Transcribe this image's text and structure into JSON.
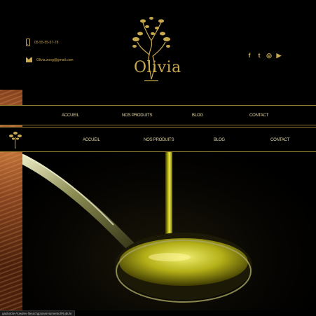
{
  "header": {
    "phone": "05-55-55-57-78",
    "email": "Olivia.zoog@gmail.com",
    "logo_text": "Olivia"
  },
  "socials": [
    {
      "icon": "facebook-icon",
      "glyph": "f"
    },
    {
      "icon": "twitter-icon",
      "glyph": "t"
    },
    {
      "icon": "instagram-icon",
      "glyph": "◎"
    },
    {
      "icon": "youtube-icon",
      "glyph": "▶"
    }
  ],
  "nav_primary": {
    "items": [
      "ACCUEIL",
      "NOS PRODUITS",
      "BLOG",
      "CONTACT"
    ]
  },
  "nav_sticky": {
    "items": [
      "ACCUEIL",
      "NOS PRODUITS",
      "BLOG",
      "CONTACT"
    ]
  },
  "status": {
    "url": "gadiotcle-/rowdev-liteu/c/gpioserviumentol/Rubu/n"
  },
  "colors": {
    "gold": "#c9a94e",
    "background": "#000000",
    "olive_oil": "#c8c420"
  }
}
